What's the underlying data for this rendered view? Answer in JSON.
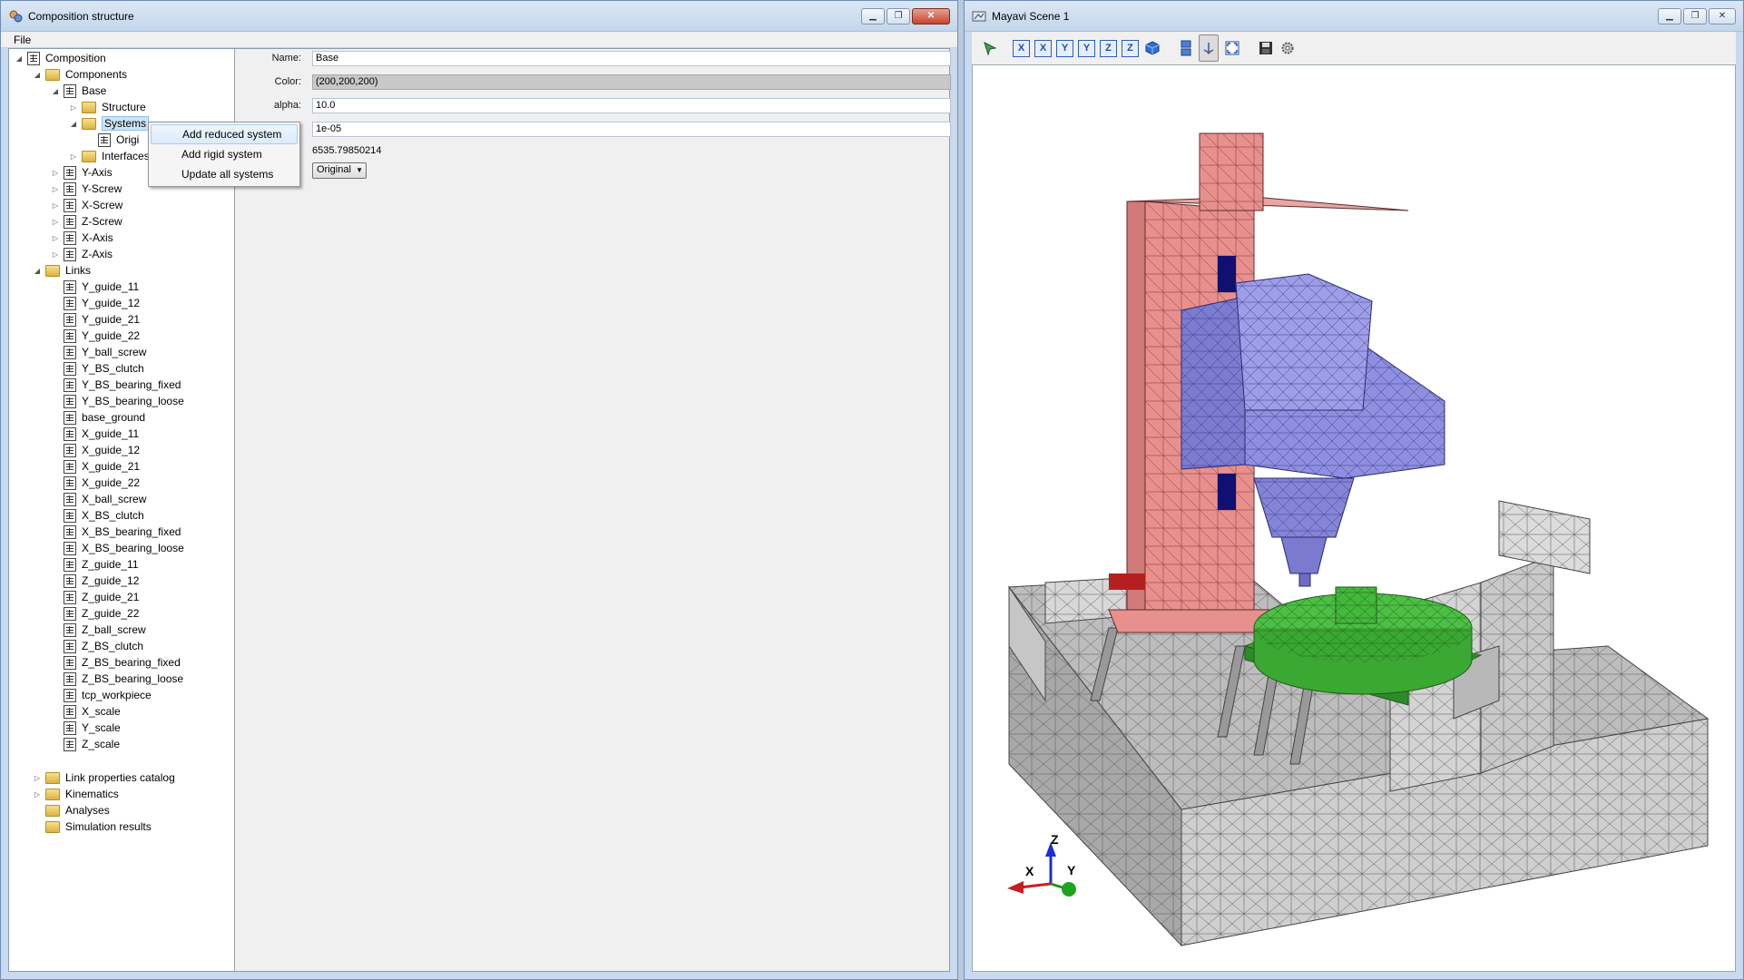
{
  "left_window": {
    "title": "Composition structure",
    "menu": {
      "file": "File"
    },
    "tree": {
      "root": "Composition",
      "components": "Components",
      "base": "Base",
      "structure": "Structure",
      "systems": "Systems",
      "original_partial": "Origi",
      "interfaces_partial": "Interfaces",
      "y_axis": "Y-Axis",
      "y_screw": "Y-Screw",
      "x_screw": "X-Screw",
      "z_screw": "Z-Screw",
      "x_axis": "X-Axis",
      "z_axis": "Z-Axis",
      "links": "Links",
      "link_items": [
        "Y_guide_11",
        "Y_guide_12",
        "Y_guide_21",
        "Y_guide_22",
        "Y_ball_screw",
        "Y_BS_clutch",
        "Y_BS_bearing_fixed",
        "Y_BS_bearing_loose",
        "base_ground",
        "X_guide_11",
        "X_guide_12",
        "X_guide_21",
        "X_guide_22",
        "X_ball_screw",
        "X_BS_clutch",
        "X_BS_bearing_fixed",
        "X_BS_bearing_loose",
        "Z_guide_11",
        "Z_guide_12",
        "Z_guide_21",
        "Z_guide_22",
        "Z_ball_screw",
        "Z_BS_clutch",
        "Z_BS_bearing_fixed",
        "Z_BS_bearing_loose",
        "tcp_workpiece",
        "X_scale",
        "Y_scale",
        "Z_scale"
      ],
      "link_properties_catalog": "Link properties catalog",
      "kinematics": "Kinematics",
      "analyses": "Analyses",
      "simulation_results": "Simulation results"
    },
    "properties": {
      "name_label": "Name:",
      "name_value": "Base",
      "color_label": "Color:",
      "color_value": "(200,200,200)",
      "alpha_label": "alpha:",
      "alpha_value": "10.0",
      "beta_label_partial": "a:",
      "beta_value": "1e-05",
      "mass_label_partial": "s:",
      "mass_value": "6535.79850214",
      "system_label_partial": "n:",
      "system_value": "Original"
    },
    "context_menu": {
      "items": [
        "Add reduced system",
        "Add rigid system",
        "Update all systems"
      ]
    }
  },
  "right_window": {
    "title": "Mayavi Scene 1",
    "toolbar": [
      "X",
      "X",
      "Y",
      "Y",
      "Z",
      "Z"
    ],
    "axes": {
      "x": "X",
      "y": "Y",
      "z": "Z"
    }
  },
  "colors": {
    "column": "#e8908e",
    "spindle": "#8f8fe0",
    "table": "#44b83c",
    "base": "#dcdcdc"
  }
}
